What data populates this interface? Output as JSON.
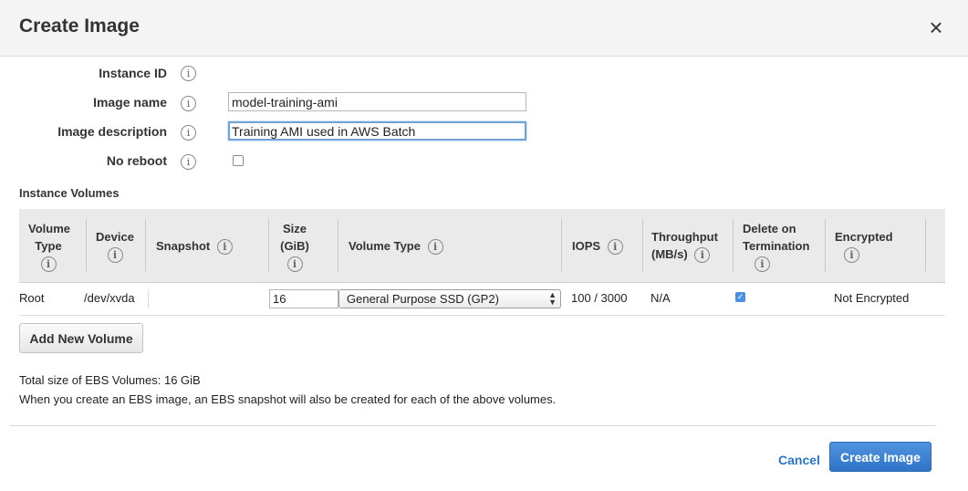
{
  "dialog": {
    "title": "Create Image",
    "close_glyph": "×"
  },
  "form": {
    "instance_id_label": "Instance ID",
    "image_name_label": "Image name",
    "image_name_value": "model-training-ami",
    "image_description_label": "Image description",
    "image_description_value": "Training AMI used in AWS Batch",
    "no_reboot_label": "No reboot",
    "no_reboot_checked": false
  },
  "info_glyph": "i",
  "volumes": {
    "section_title": "Instance Volumes",
    "headers": {
      "volume_type_1": "Volume",
      "volume_type_2": "Type",
      "device": "Device",
      "snapshot": "Snapshot",
      "size_1": "Size",
      "size_2": "(GiB)",
      "volume_type_col": "Volume Type",
      "iops": "IOPS",
      "throughput_1": "Throughput",
      "throughput_2": "(MB/s)",
      "delete_1": "Delete on",
      "delete_2": "Termination",
      "encrypted": "Encrypted"
    },
    "row": {
      "volume_type": "Root",
      "device": "/dev/xvda",
      "snapshot": "",
      "size": "16",
      "volume_type_select": "General Purpose SSD (GP2)",
      "iops": "100 / 3000",
      "throughput": "N/A",
      "delete_on_termination": true,
      "check_glyph": "✓",
      "encrypted": "Not Encrypted"
    },
    "add_button": "Add New Volume"
  },
  "summary": {
    "total_size": "Total size of EBS Volumes: 16 GiB",
    "note": "When you create an EBS image, an EBS snapshot will also be created for each of the above volumes."
  },
  "footer": {
    "cancel": "Cancel",
    "create": "Create Image"
  },
  "colors": {
    "primary": "#2f74c8",
    "link": "#2c73c9",
    "header_bg": "#f4f4f4",
    "table_head_bg": "#eaeaea"
  }
}
